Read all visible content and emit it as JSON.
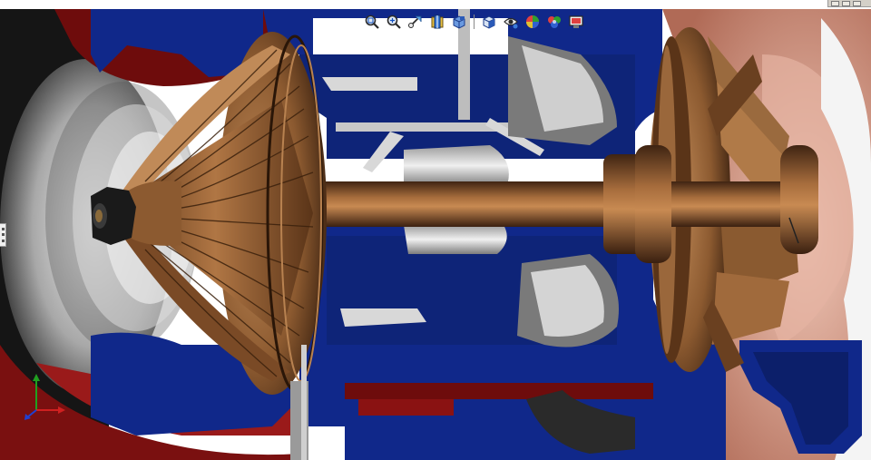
{
  "hud_toolbar": {
    "items": [
      {
        "id": "zoom-to-fit",
        "icon": "zoom-to-fit-icon"
      },
      {
        "id": "zoom-to-area",
        "icon": "zoom-to-area-icon"
      },
      {
        "id": "previous-view",
        "icon": "previous-view-icon"
      },
      {
        "id": "section-view",
        "icon": "section-view-icon"
      },
      {
        "id": "view-orientation",
        "icon": "view-orientation-icon"
      },
      {
        "id": "display-style",
        "icon": "display-style-icon"
      },
      {
        "id": "hide-show-items",
        "icon": "hide-show-items-icon"
      },
      {
        "id": "edit-appearance",
        "icon": "edit-appearance-icon"
      },
      {
        "id": "apply-scene",
        "icon": "apply-scene-icon"
      },
      {
        "id": "view-settings",
        "icon": "view-settings-icon"
      }
    ]
  },
  "triad": {
    "axes": [
      "X",
      "Y",
      "Z"
    ],
    "colors": {
      "x": "#d02020",
      "y": "#20a020",
      "z": "#2040d0"
    }
  },
  "colors": {
    "housing_blue": "#10288a",
    "housing_red": "#8a1212",
    "shaft_bronze": "#7a4a26",
    "background": "#ffffff"
  }
}
